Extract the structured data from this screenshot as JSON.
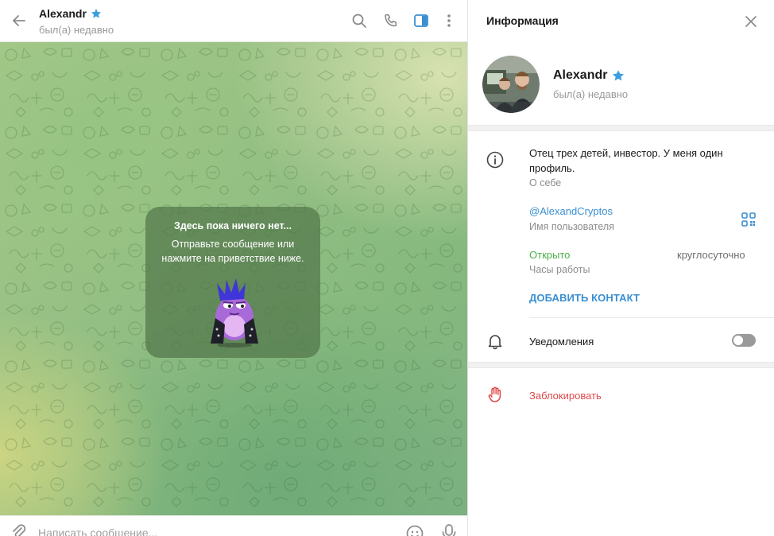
{
  "chat": {
    "peer_name": "Alexandr",
    "peer_status": "был(а) недавно",
    "empty_title": "Здесь пока ничего нет...",
    "empty_subtitle": "Отправьте сообщение или нажмите на приветствие ниже.",
    "composer_placeholder": "Написать сообщение..."
  },
  "info": {
    "title": "Информация",
    "profile_name": "Alexandr",
    "profile_status": "был(а) недавно",
    "bio": "Отец трех детей, инвестор. У меня один профиль.",
    "bio_label": "О себе",
    "username": "@AlexandCryptos",
    "username_label": "Имя пользователя",
    "hours_status": "Открыто",
    "hours_value": "круглосуточно",
    "hours_label": "Часы работы",
    "add_contact": "ДОБАВИТЬ КОНТАКТ",
    "notifications_label": "Уведомления",
    "notifications_enabled": false,
    "block_label": "Заблокировать"
  },
  "icons": {
    "back": "arrow-left-icon",
    "search": "search-icon",
    "call": "phone-icon",
    "sidebar": "sidebar-toggle-icon",
    "more": "more-vertical-icon",
    "close": "close-icon",
    "info": "info-icon",
    "qr": "qr-code-icon",
    "bell": "bell-icon",
    "block": "hand-stop-icon",
    "attach": "paperclip-icon",
    "emoji": "smile-icon",
    "mic": "microphone-icon",
    "premium_star": "star-icon"
  },
  "colors": {
    "accent": "#3a8fd1",
    "open_green": "#4cb04c",
    "danger": "#e04848",
    "star": "#3a9de0",
    "toggle_off": "#9a9a9a"
  }
}
